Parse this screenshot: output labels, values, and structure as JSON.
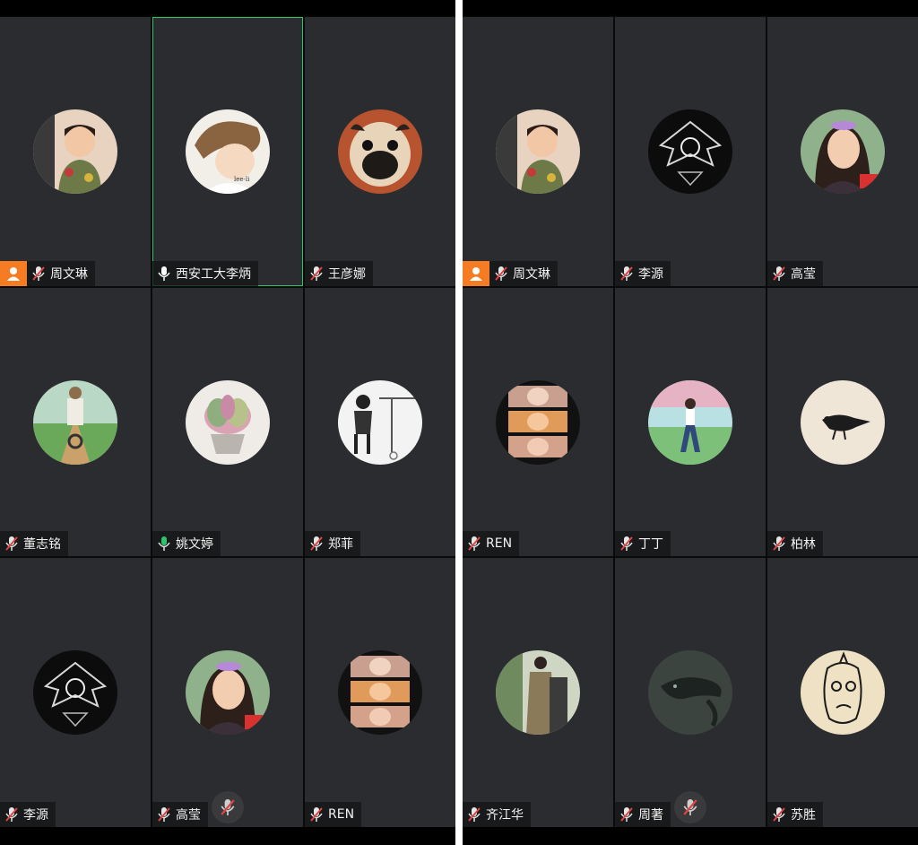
{
  "colors": {
    "tile_bg": "#2b2c2f",
    "host_badge": "#f57c22",
    "active_border": "#2fc46a",
    "mic_on": "#2fc46a",
    "mic_off_slash": "#e04545"
  },
  "left_panel": {
    "tiles": [
      {
        "name": "周文琳",
        "mic": "muted",
        "host": true,
        "avatar": "child-photo-avatar"
      },
      {
        "name": "西安工大李炳",
        "mic": "on",
        "active": true,
        "avatar": "anime-boy-avatar"
      },
      {
        "name": "王彦娜",
        "mic": "muted",
        "avatar": "pug-dog-avatar"
      },
      {
        "name": "董志铭",
        "mic": "muted",
        "avatar": "bicycle-illustration-avatar"
      },
      {
        "name": "姚文婷",
        "mic": "on",
        "avatar": "succulent-plant-avatar"
      },
      {
        "name": "郑菲",
        "mic": "muted",
        "avatar": "bw-child-photo-avatar"
      },
      {
        "name": "李源",
        "mic": "muted",
        "avatar": "dark-emblem-avatar"
      },
      {
        "name": "高莹",
        "mic": "muted",
        "avatar": "woman-selfie-avatar"
      },
      {
        "name": "REN",
        "mic": "muted",
        "avatar": "face-collage-avatar"
      }
    ]
  },
  "right_panel": {
    "tiles": [
      {
        "name": "周文琳",
        "mic": "muted",
        "host": true,
        "avatar": "child-photo-avatar"
      },
      {
        "name": "李源",
        "mic": "muted",
        "avatar": "dark-emblem-avatar"
      },
      {
        "name": "高莹",
        "mic": "muted",
        "avatar": "woman-selfie-avatar"
      },
      {
        "name": "REN",
        "mic": "muted",
        "avatar": "face-collage-avatar"
      },
      {
        "name": "丁丁",
        "mic": "muted",
        "avatar": "girl-walking-illustration-avatar"
      },
      {
        "name": "柏林",
        "mic": "muted",
        "avatar": "ink-bird-avatar"
      },
      {
        "name": "齐江华",
        "mic": "muted",
        "avatar": "woman-dress-photo-avatar"
      },
      {
        "name": "周著",
        "mic": "muted",
        "avatar": "whale-avatar"
      },
      {
        "name": "苏胜",
        "mic": "muted",
        "avatar": "sketch-face-avatar"
      }
    ]
  }
}
